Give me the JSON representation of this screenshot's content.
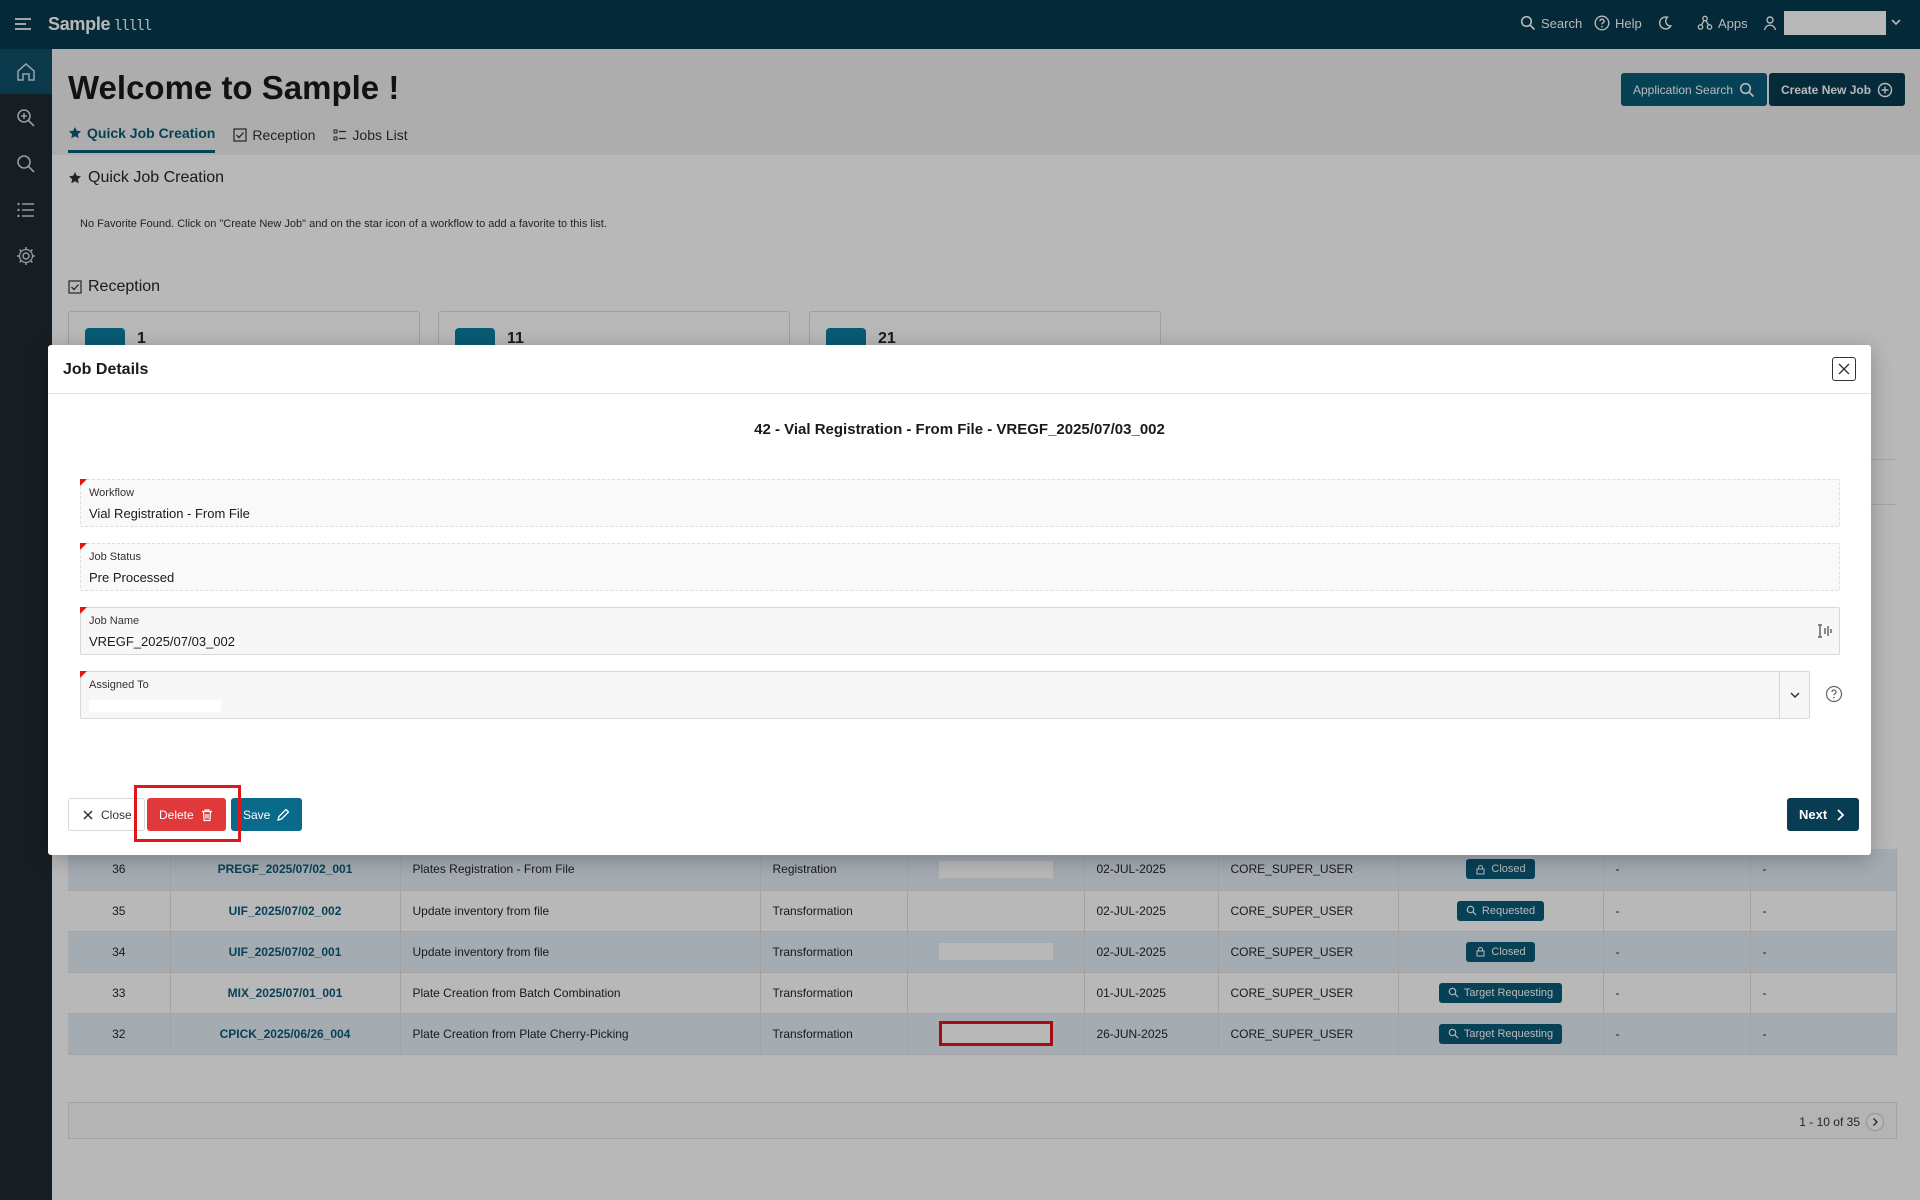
{
  "topbar": {
    "brand": "Sample",
    "brand_mark": "lllll",
    "search": "Search",
    "help": "Help",
    "apps": "Apps"
  },
  "header": {
    "title": "Welcome to Sample !",
    "app_search_btn": "Application Search",
    "create_job_btn": "Create New Job",
    "tabs": [
      {
        "label": "Quick Job Creation"
      },
      {
        "label": "Reception"
      },
      {
        "label": "Jobs List"
      }
    ]
  },
  "quick_job": {
    "heading": "Quick Job Creation",
    "empty_message": "No Favorite Found. Click on \"Create New Job\" and on the star icon of a workflow to add a favorite to this list."
  },
  "reception": {
    "heading": "Reception",
    "cards": [
      {
        "count": "1"
      },
      {
        "count": "11"
      },
      {
        "count": "21"
      }
    ]
  },
  "jobs_table": {
    "rows": [
      {
        "id": "36",
        "name": "PREGF_2025/07/02_001",
        "description": "Plates Registration - From File",
        "type": "Registration",
        "date": "02-JUL-2025",
        "user": "CORE_SUPER_USER",
        "status": "Closed",
        "status_icon": "lock-icon",
        "c1": "-",
        "c2": "-"
      },
      {
        "id": "35",
        "name": "UIF_2025/07/02_002",
        "description": "Update inventory from file",
        "type": "Transformation",
        "date": "02-JUL-2025",
        "user": "CORE_SUPER_USER",
        "status": "Requested",
        "status_icon": "search-icon",
        "c1": "-",
        "c2": "-"
      },
      {
        "id": "34",
        "name": "UIF_2025/07/02_001",
        "description": "Update inventory from file",
        "type": "Transformation",
        "date": "02-JUL-2025",
        "user": "CORE_SUPER_USER",
        "status": "Closed",
        "status_icon": "lock-icon",
        "c1": "-",
        "c2": "-"
      },
      {
        "id": "33",
        "name": "MIX_2025/07/01_001",
        "description": "Plate Creation from Batch Combination",
        "type": "Transformation",
        "date": "01-JUL-2025",
        "user": "CORE_SUPER_USER",
        "status": "Target Requesting",
        "status_icon": "search-icon",
        "c1": "-",
        "c2": "-"
      },
      {
        "id": "32",
        "name": "CPICK_2025/06/26_004",
        "description": "Plate Creation from Plate Cherry-Picking",
        "type": "Transformation",
        "date": "26-JUN-2025",
        "user": "CORE_SUPER_USER",
        "status": "Target Requesting",
        "status_icon": "search-icon",
        "c1": "-",
        "c2": "-"
      }
    ],
    "pagination": "1 - 10 of 35"
  },
  "dialog": {
    "title": "Job Details",
    "subtitle": "42 - Vial Registration - From File - VREGF_2025/07/03_002",
    "fields": {
      "workflow": {
        "label": "Workflow",
        "value": "Vial Registration - From File"
      },
      "job_status": {
        "label": "Job Status",
        "value": "Pre Processed"
      },
      "job_name": {
        "label": "Job Name",
        "value": "VREGF_2025/07/03_002"
      },
      "assigned_to": {
        "label": "Assigned To",
        "value": ""
      }
    },
    "buttons": {
      "close": "Close",
      "delete": "Delete",
      "save": "Save",
      "next": "Next"
    }
  },
  "colors": {
    "topbar": "#063a4f",
    "primary": "#0a5b78",
    "danger": "#e0393b",
    "highlight": "#e0161b"
  }
}
